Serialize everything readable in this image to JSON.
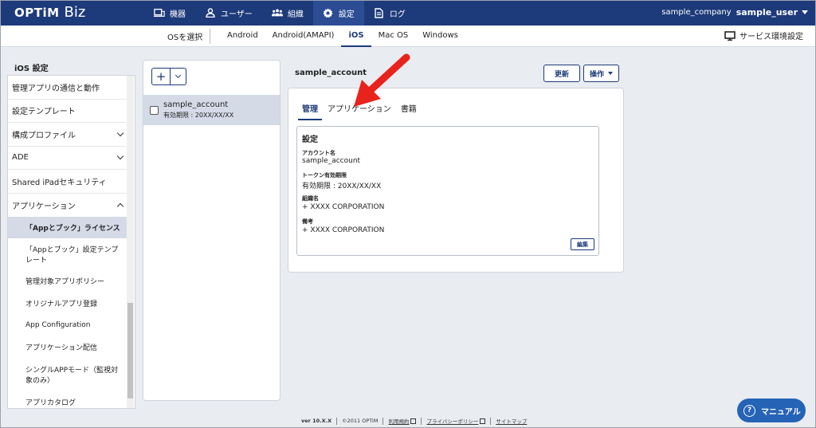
{
  "brand": {
    "logo_main": "OPTiM",
    "logo_sub": "Biz"
  },
  "topnav": [
    {
      "label": "機器",
      "icon": "device-icon"
    },
    {
      "label": "ユーザー",
      "icon": "user-icon"
    },
    {
      "label": "組織",
      "icon": "organization-icon"
    },
    {
      "label": "設定",
      "icon": "gear-icon"
    },
    {
      "label": "ログ",
      "icon": "log-icon"
    }
  ],
  "user": {
    "company": "sample_company",
    "name": "sample_user"
  },
  "osbar": {
    "select_label": "OSを選択",
    "tabs": [
      "Android",
      "Android(AMAPI)",
      "iOS",
      "Mac OS",
      "Windows"
    ],
    "active_tab": "iOS",
    "service_settings": "サービス環境設定"
  },
  "sidebar": {
    "title": "iOS 設定",
    "items": [
      {
        "label": "管理アプリの通信と動作"
      },
      {
        "label": "設定テンプレート"
      },
      {
        "label": "構成プロファイル"
      },
      {
        "label": "ADE"
      },
      {
        "label": "Shared iPadセキュリティ"
      },
      {
        "label": "アプリケーション"
      }
    ],
    "subitems": [
      {
        "label": "「Appとブック」ライセンス"
      },
      {
        "label": "「Appとブック」設定テンプレート"
      },
      {
        "label": "管理対象アプリポリシー"
      },
      {
        "label": "オリジナルアプリ登録"
      },
      {
        "label": "App Configuration"
      },
      {
        "label": "アプリケーション配信"
      },
      {
        "label": "シングルAPPモード（監視対象のみ）"
      },
      {
        "label": "アプリカタログ"
      }
    ]
  },
  "list": {
    "add_label": "+",
    "account": {
      "name": "sample_account",
      "expiry": "有効期限 : 20XX/XX/XX"
    }
  },
  "detail": {
    "title": "sample_account",
    "update_button": "更新",
    "ops_button": "操作",
    "tabs": [
      "管理",
      "アプリケーション",
      "書籍"
    ],
    "settings": {
      "title": "設定",
      "fields": [
        {
          "label": "アカウント名",
          "value": "sample_account"
        },
        {
          "label": "トークン有効期限",
          "value": "有効期限 : 20XX/XX/XX"
        },
        {
          "label": "組織名",
          "value": "+ XXXX CORPORATION"
        },
        {
          "label": "備考",
          "value": "+ XXXX CORPORATION"
        }
      ],
      "edit_button": "編集"
    }
  },
  "footer": {
    "version": "ver 10.X.X",
    "copyright": "©2011 OPTiM",
    "terms": "利用規約",
    "privacy": "プライバシーポリシー",
    "sitemap": "サイトマップ"
  },
  "manual_button": "マニュアル",
  "colors": {
    "header": "#1d3a7a",
    "accent": "#2563b6",
    "arrow": "#e8231c",
    "selected_bg": "#d4dbe7"
  }
}
